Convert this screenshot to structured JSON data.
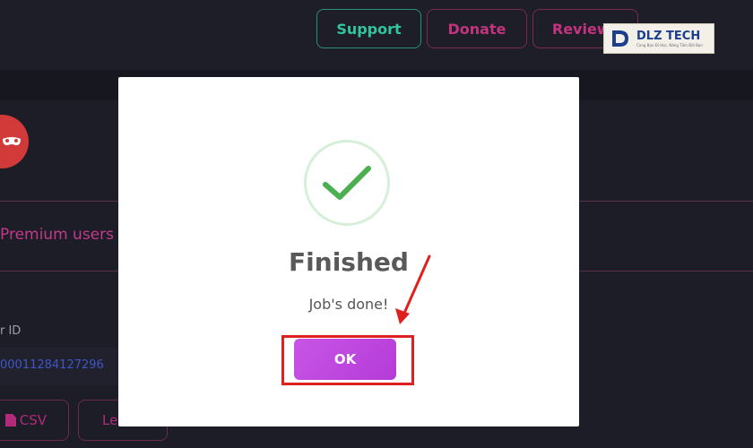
{
  "header": {
    "support_label": "Support",
    "donate_label": "Donate",
    "reviews_label": "Reviews"
  },
  "watermark": {
    "title": "DLZ TECH",
    "subtitle": "Cùng Bạn Đi Học, Nâng Tầm Đời Bạn"
  },
  "background": {
    "premium_label": "Premium users",
    "id_label": "r ID",
    "id_value": "00011284127296",
    "csv_label": "CSV",
    "second_button_label": "Le"
  },
  "dialog": {
    "title": "Finished",
    "message": "Job's done!",
    "ok_label": "OK"
  },
  "colors": {
    "success": "#4caf50",
    "ok_button": "#c04be0",
    "highlight": "#e0201f"
  },
  "icons": [
    "checkmark-icon",
    "mask-icon",
    "file-icon",
    "dlz-logo-icon"
  ]
}
